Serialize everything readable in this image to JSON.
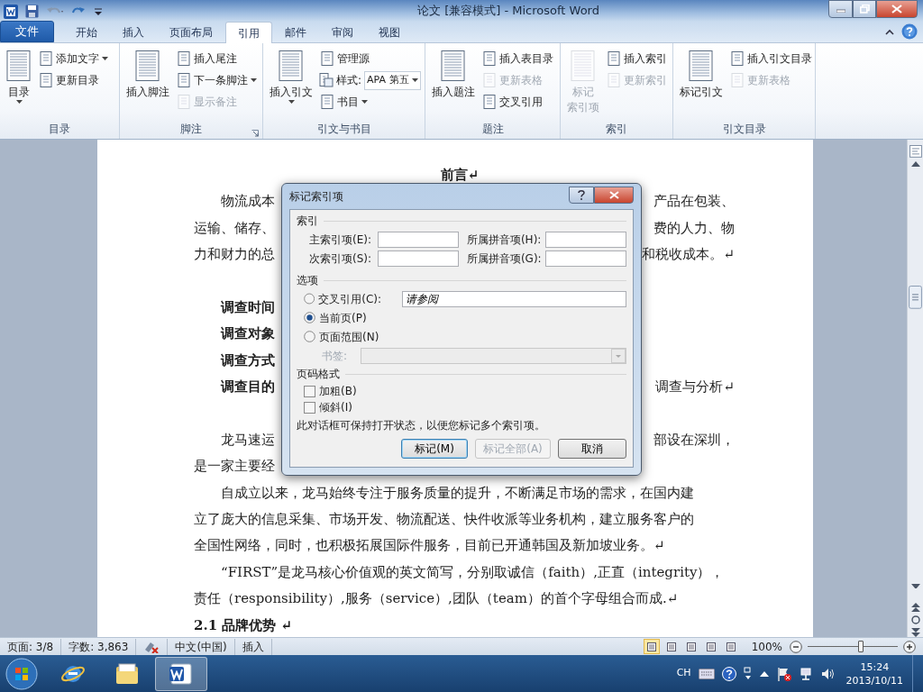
{
  "window": {
    "title": "论文 [兼容模式] - Microsoft Word"
  },
  "tabs": [
    {
      "label": "文件",
      "kind": "file",
      "selected": false
    },
    {
      "label": "开始",
      "kind": "tab",
      "selected": false
    },
    {
      "label": "插入",
      "kind": "tab",
      "selected": false
    },
    {
      "label": "页面布局",
      "kind": "tab",
      "selected": false
    },
    {
      "label": "引用",
      "kind": "tab",
      "selected": true
    },
    {
      "label": "邮件",
      "kind": "tab",
      "selected": false
    },
    {
      "label": "审阅",
      "kind": "tab",
      "selected": false
    },
    {
      "label": "视图",
      "kind": "tab",
      "selected": false
    }
  ],
  "ribbon_groups": [
    {
      "label": "目录",
      "items": [
        {
          "kind": "large",
          "label": "目录",
          "dropdown": true,
          "disabled": false
        },
        {
          "kind": "small",
          "label": "添加文字",
          "dropdown": true,
          "disabled": false
        },
        {
          "kind": "small",
          "label": "更新目录",
          "dropdown": false,
          "disabled": false
        }
      ]
    },
    {
      "label": "脚注",
      "launcher": true,
      "items": [
        {
          "kind": "large",
          "label": "插入脚注",
          "dropdown": false,
          "disabled": false
        },
        {
          "kind": "small",
          "label": "插入尾注",
          "dropdown": false,
          "disabled": false
        },
        {
          "kind": "small",
          "label": "下一条脚注",
          "dropdown": true,
          "disabled": false
        },
        {
          "kind": "small",
          "label": "显示备注",
          "dropdown": false,
          "disabled": true
        }
      ]
    },
    {
      "label": "引文与书目",
      "items": [
        {
          "kind": "large",
          "label": "插入引文",
          "dropdown": true,
          "disabled": false
        },
        {
          "kind": "small",
          "label": "管理源",
          "dropdown": false,
          "disabled": false
        },
        {
          "kind": "combo",
          "label": "样式:",
          "value": "APA 第五",
          "dropdown": true,
          "disabled": false
        },
        {
          "kind": "small",
          "label": "书目",
          "dropdown": true,
          "disabled": false
        }
      ]
    },
    {
      "label": "题注",
      "items": [
        {
          "kind": "large",
          "label": "插入题注",
          "dropdown": false,
          "disabled": false
        },
        {
          "kind": "small",
          "label": "插入表目录",
          "dropdown": false,
          "disabled": false
        },
        {
          "kind": "small",
          "label": "更新表格",
          "dropdown": false,
          "disabled": true
        },
        {
          "kind": "small",
          "label": "交叉引用",
          "dropdown": false,
          "disabled": false
        }
      ]
    },
    {
      "label": "索引",
      "items": [
        {
          "kind": "large",
          "label": "标记",
          "label_2": "索引项",
          "dropdown": false,
          "disabled": true
        },
        {
          "kind": "small",
          "label": "插入索引",
          "dropdown": false,
          "disabled": false
        },
        {
          "kind": "small",
          "label": "更新索引",
          "dropdown": false,
          "disabled": true
        }
      ]
    },
    {
      "label": "引文目录",
      "items": [
        {
          "kind": "large",
          "label": "标记引文",
          "dropdown": false,
          "disabled": false
        },
        {
          "kind": "small",
          "label": "插入引文目录",
          "dropdown": false,
          "disabled": false
        },
        {
          "kind": "small",
          "label": "更新表格",
          "dropdown": false,
          "disabled": true
        }
      ]
    }
  ],
  "document": {
    "lines": [
      {
        "kind": "heading",
        "left": "前言↵"
      },
      {
        "kind": "text",
        "indent": true,
        "bold": false,
        "left": "物流成本",
        "right": "产品在包装、"
      },
      {
        "kind": "text",
        "indent": false,
        "bold": false,
        "left": "运输、储存、",
        "right": "费的人力、物"
      },
      {
        "kind": "text",
        "indent": false,
        "bold": false,
        "left": "力和财力的总",
        "right": "和税收成本。↵"
      },
      {
        "kind": "blank"
      },
      {
        "kind": "text",
        "indent": true,
        "bold": true,
        "left": "调查时间"
      },
      {
        "kind": "text",
        "indent": true,
        "bold": true,
        "left": "调查对象"
      },
      {
        "kind": "text",
        "indent": true,
        "bold": true,
        "left": "调查方式"
      },
      {
        "kind": "text",
        "indent": true,
        "bold": true,
        "left": "调查目的",
        "right": "调查与分析↵"
      },
      {
        "kind": "blank"
      },
      {
        "kind": "text",
        "indent": true,
        "bold": false,
        "left": "龙马速运",
        "right": "部设在深圳，"
      },
      {
        "kind": "text",
        "indent": false,
        "bold": false,
        "left": "是一家主要经"
      },
      {
        "kind": "text",
        "indent": true,
        "bold": false,
        "left": "自成立以来，龙马始终专注于服务质量的提升，不断满足市场的需求，在国内建"
      },
      {
        "kind": "continued",
        "left": "立了庞大的信息采集、市场开发、物流配送、快件收派等业务机构，建立服务客户的"
      },
      {
        "kind": "continued",
        "left": "全国性网络，同时，也积极拓展国际件服务，目前已开通韩国及新加坡业务。↵"
      },
      {
        "kind": "text",
        "indent": true,
        "bold": false,
        "left": "“FIRST”是龙马核心价值观的英文简写，分别取诚信（faith）,正直（integrity），"
      },
      {
        "kind": "continued",
        "left": "责任（responsibility）,服务（service）,团队（team）的首个字母组合而成.↵"
      },
      {
        "kind": "text",
        "indent": false,
        "bold": true,
        "left": "2.1  品牌优势 ↵"
      }
    ]
  },
  "dialog": {
    "title": "标记索引项",
    "index_section": {
      "label": "索引",
      "fields": [
        {
          "label": "主索引项(E):"
        },
        {
          "label": "所属拼音项(H):"
        },
        {
          "label": "次索引项(S):"
        },
        {
          "label": "所属拼音项(G):"
        }
      ]
    },
    "options_section": {
      "label": "选项",
      "radios": [
        {
          "label": "交叉引用(C):",
          "selected": false,
          "value": "请参阅"
        },
        {
          "label": "当前页(P)",
          "selected": true
        },
        {
          "label": "页面范围(N)",
          "selected": false
        }
      ],
      "bookmark": {
        "label": "书签:",
        "disabled": true
      }
    },
    "format_section": {
      "label": "页码格式",
      "checkboxes": [
        {
          "label": "加粗(B)",
          "checked": false
        },
        {
          "label": "倾斜(I)",
          "checked": false
        }
      ]
    },
    "note": "此对话框可保持打开状态，以便您标记多个索引项。",
    "buttons": [
      {
        "label": "标记(M)",
        "default": true,
        "disabled": false
      },
      {
        "label": "标记全部(A)",
        "default": false,
        "disabled": true
      },
      {
        "label": "取消",
        "default": false,
        "disabled": false
      }
    ]
  },
  "status_bar": {
    "items": [
      "页面: 3/8",
      "字数: 3,863",
      "中文(中国)",
      "插入"
    ],
    "views": [
      {
        "selected": true
      },
      {
        "selected": false
      },
      {
        "selected": false
      },
      {
        "selected": false
      },
      {
        "selected": false
      }
    ],
    "zoom": "100%",
    "zoom_slider": {
      "level": 0.6
    }
  },
  "taskbar": {
    "apps": [
      {
        "selected": false
      },
      {
        "selected": false
      },
      {
        "selected": true
      }
    ],
    "language": "CH",
    "time": "15:24",
    "date": "2013/10/11"
  }
}
